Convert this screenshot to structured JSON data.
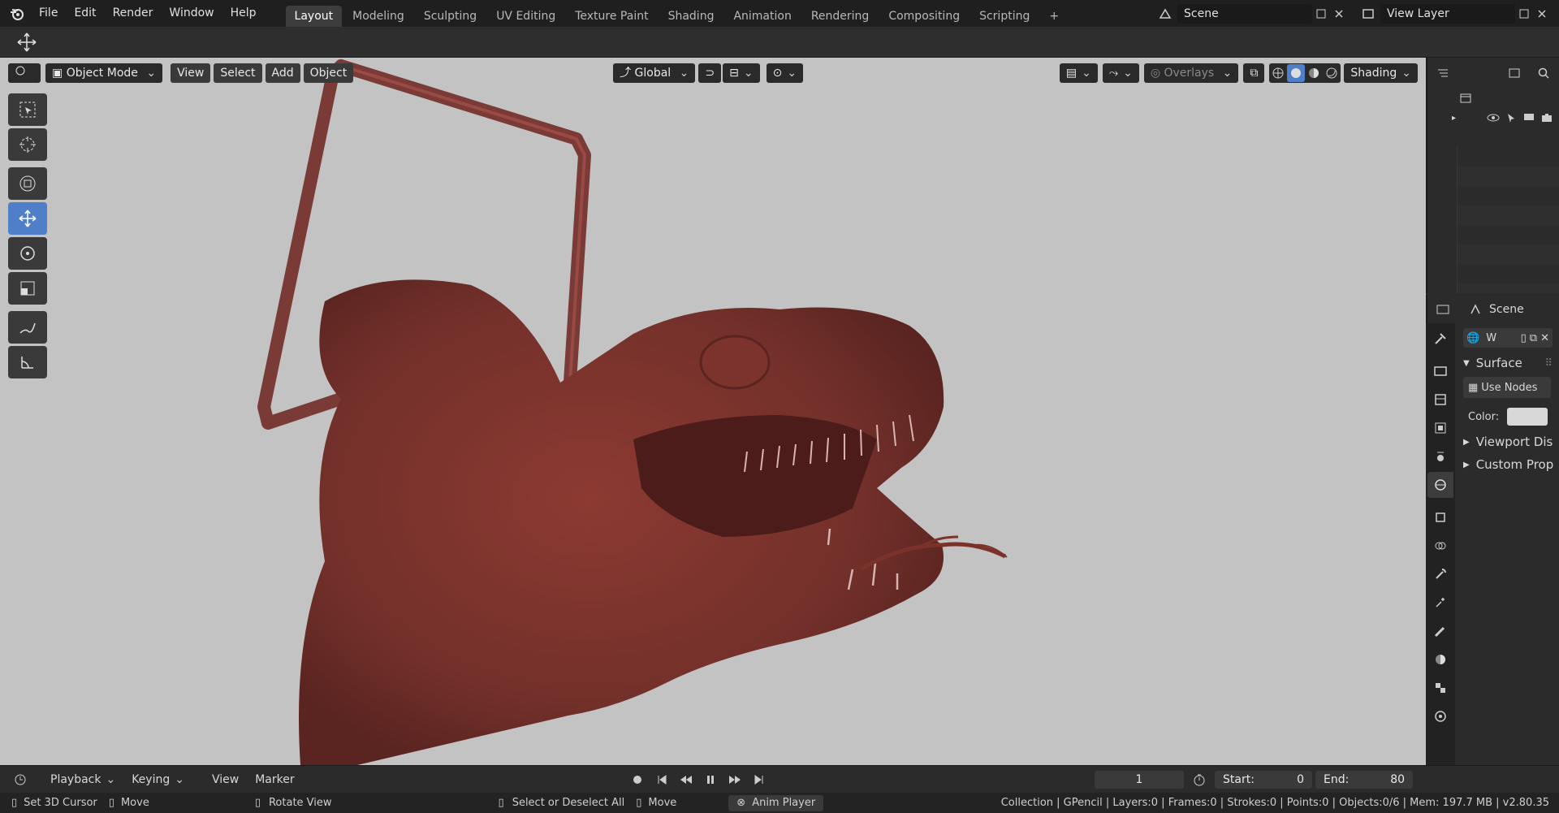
{
  "topbar": {
    "menus": [
      "File",
      "Edit",
      "Render",
      "Window",
      "Help"
    ],
    "workspaces": [
      "Layout",
      "Modeling",
      "Sculpting",
      "UV Editing",
      "Texture Paint",
      "Shading",
      "Animation",
      "Rendering",
      "Compositing",
      "Scripting"
    ],
    "add_tab": "+",
    "scene": "Scene",
    "view_layer": "View Layer"
  },
  "viewport": {
    "mode": "Object Mode",
    "menus": [
      "View",
      "Select",
      "Add",
      "Object"
    ],
    "orientation": "Global",
    "overlays": "Overlays",
    "shading": "Shading"
  },
  "properties": {
    "header": "Scene",
    "world_name": "W",
    "surface": "Surface",
    "use_nodes": "Use Nodes",
    "color_label": "Color:",
    "color_value": "#d8d8d8",
    "viewport_display": "Viewport Dis",
    "custom_props": "Custom Prop"
  },
  "timeline": {
    "menus": [
      "Playback",
      "Keying",
      "View",
      "Marker"
    ],
    "current_frame": "1",
    "start_label": "Start:",
    "start": "0",
    "end_label": "End:",
    "end": "80"
  },
  "statusbar": {
    "left": [
      "Set 3D Cursor",
      "Move",
      "Rotate View"
    ],
    "middle": [
      "Select or Deselect All",
      "Move"
    ],
    "anim_player": "Anim Player",
    "stats": "Collection | GPencil | Layers:0 | Frames:0 | Strokes:0 | Points:0 | Objects:0/6 | Mem: 197.7 MB | v2.80.35"
  },
  "colors": {
    "viewport_bg": "#c3c3c3",
    "model": "#7a2f2a",
    "active_tool": "#4f7fc9"
  }
}
